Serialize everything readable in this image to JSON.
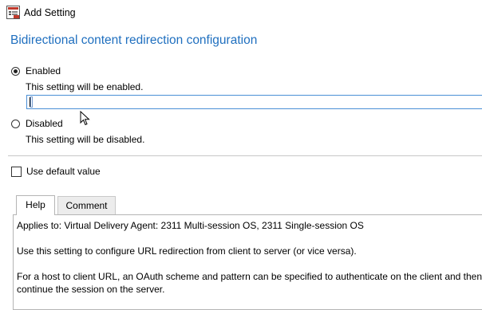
{
  "window": {
    "title": "Add Setting"
  },
  "setting": {
    "heading": "Bidirectional content redirection configuration",
    "enabled_label": "Enabled",
    "enabled_desc": "This setting will be enabled.",
    "input_value": "",
    "disabled_label": "Disabled",
    "disabled_desc": "This setting will be disabled.",
    "selected": "Enabled",
    "use_default_label": "Use default value",
    "use_default_checked": false
  },
  "tabs": [
    {
      "label": "Help",
      "active": true
    },
    {
      "label": "Comment",
      "active": false
    }
  ],
  "help": {
    "applies_to": "Applies to: Virtual Delivery Agent: 2311 Multi-session OS, 2311 Single-session OS",
    "para1": "Use this setting to configure URL redirection from client to server (or vice versa).",
    "para2_line1": "For a host to client URL, an OAuth scheme and pattern can be specified to authenticate on the client and then",
    "para2_line2": "continue the session on the server."
  },
  "colors": {
    "heading": "#1f6fbf",
    "input_border": "#4a8fd6"
  },
  "icons": {
    "app": "settings-dialog-icon",
    "cursor": "mouse-pointer-icon"
  }
}
